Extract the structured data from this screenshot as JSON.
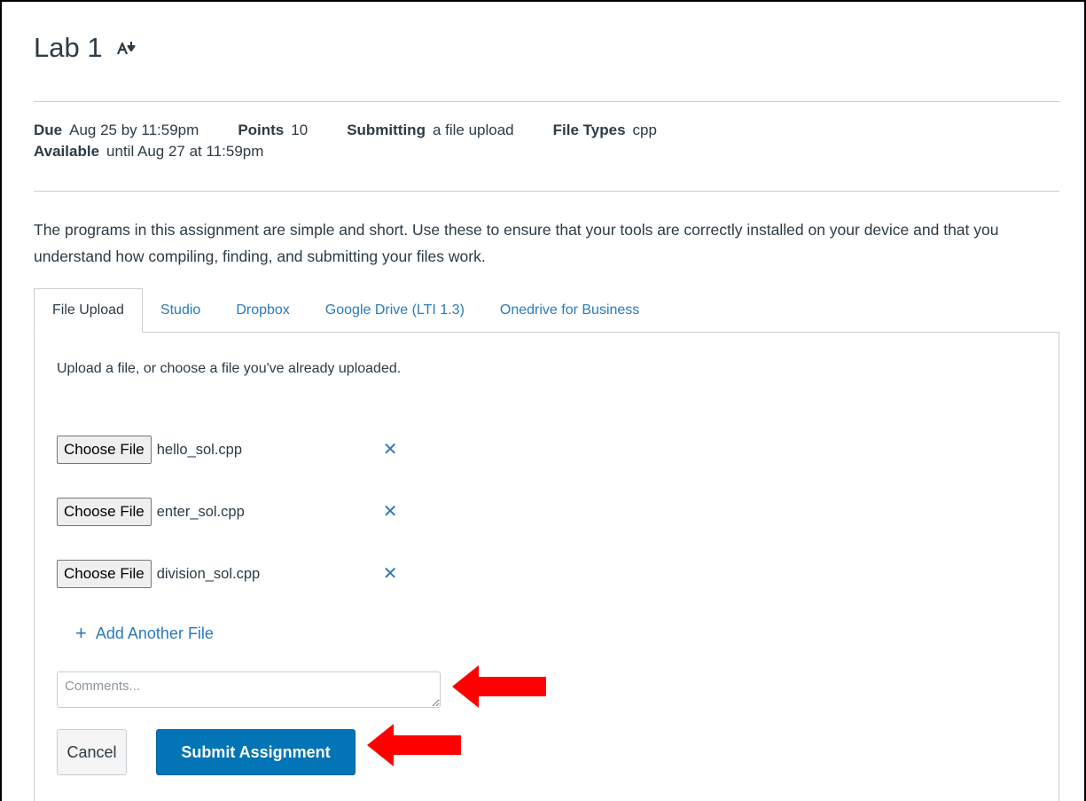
{
  "assignment": {
    "title": "Lab 1",
    "title_icon": "publish-icon"
  },
  "details": {
    "due_label": "Due",
    "due_value": "Aug 25 by 11:59pm",
    "points_label": "Points",
    "points_value": "10",
    "submitting_label": "Submitting",
    "submitting_value": "a file upload",
    "file_types_label": "File Types",
    "file_types_value": "cpp",
    "available_label": "Available",
    "available_value": "until Aug 27 at 11:59pm"
  },
  "description": "The programs in this assignment are simple and short. Use these to ensure that your tools are correctly installed on your device and that you understand how compiling, finding, and submitting your files work.",
  "tabs": [
    {
      "label": "File Upload",
      "active": true
    },
    {
      "label": "Studio",
      "active": false
    },
    {
      "label": "Dropbox",
      "active": false
    },
    {
      "label": "Google Drive (LTI 1.3)",
      "active": false
    },
    {
      "label": "Onedrive for Business",
      "active": false
    }
  ],
  "upload": {
    "hint": "Upload a file, or choose a file you've already uploaded.",
    "choose_label": "Choose File",
    "files": [
      {
        "name": "hello_sol.cpp"
      },
      {
        "name": "enter_sol.cpp"
      },
      {
        "name": "division_sol.cpp"
      }
    ],
    "remove_glyph": "✕",
    "add_label": "Add Another File",
    "add_glyph": "+"
  },
  "comments": {
    "placeholder": "Comments...",
    "value": ""
  },
  "actions": {
    "cancel_label": "Cancel",
    "submit_label": "Submit Assignment"
  },
  "colors": {
    "link": "#2b7abc",
    "primary": "#0374b5",
    "annotation_arrow": "#ff0000"
  }
}
